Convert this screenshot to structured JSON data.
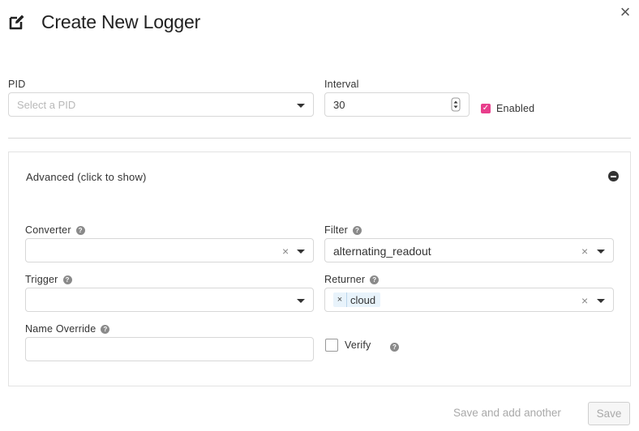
{
  "dialog": {
    "title": "Create New Logger",
    "icon": "edit-icon",
    "close_glyph": "×"
  },
  "pid": {
    "label": "PID",
    "placeholder": "Select a PID"
  },
  "interval": {
    "label": "Interval",
    "value": "30"
  },
  "enabled": {
    "label": "Enabled",
    "checked": true,
    "check_color": "#e83e8c"
  },
  "advanced": {
    "toggle_label": "Advanced (click to show)",
    "converter": {
      "label": "Converter",
      "value": ""
    },
    "filter": {
      "label": "Filter",
      "value": "alternating_readout"
    },
    "trigger": {
      "label": "Trigger",
      "value": ""
    },
    "returner": {
      "label": "Returner",
      "tags": [
        "cloud"
      ]
    },
    "name_override": {
      "label": "Name Override",
      "value": ""
    },
    "verify": {
      "label": "Verify",
      "checked": false
    }
  },
  "help_glyph": "?",
  "clear_glyph": "×",
  "footer": {
    "save_and_add_label": "Save and add another",
    "save_label": "Save"
  }
}
